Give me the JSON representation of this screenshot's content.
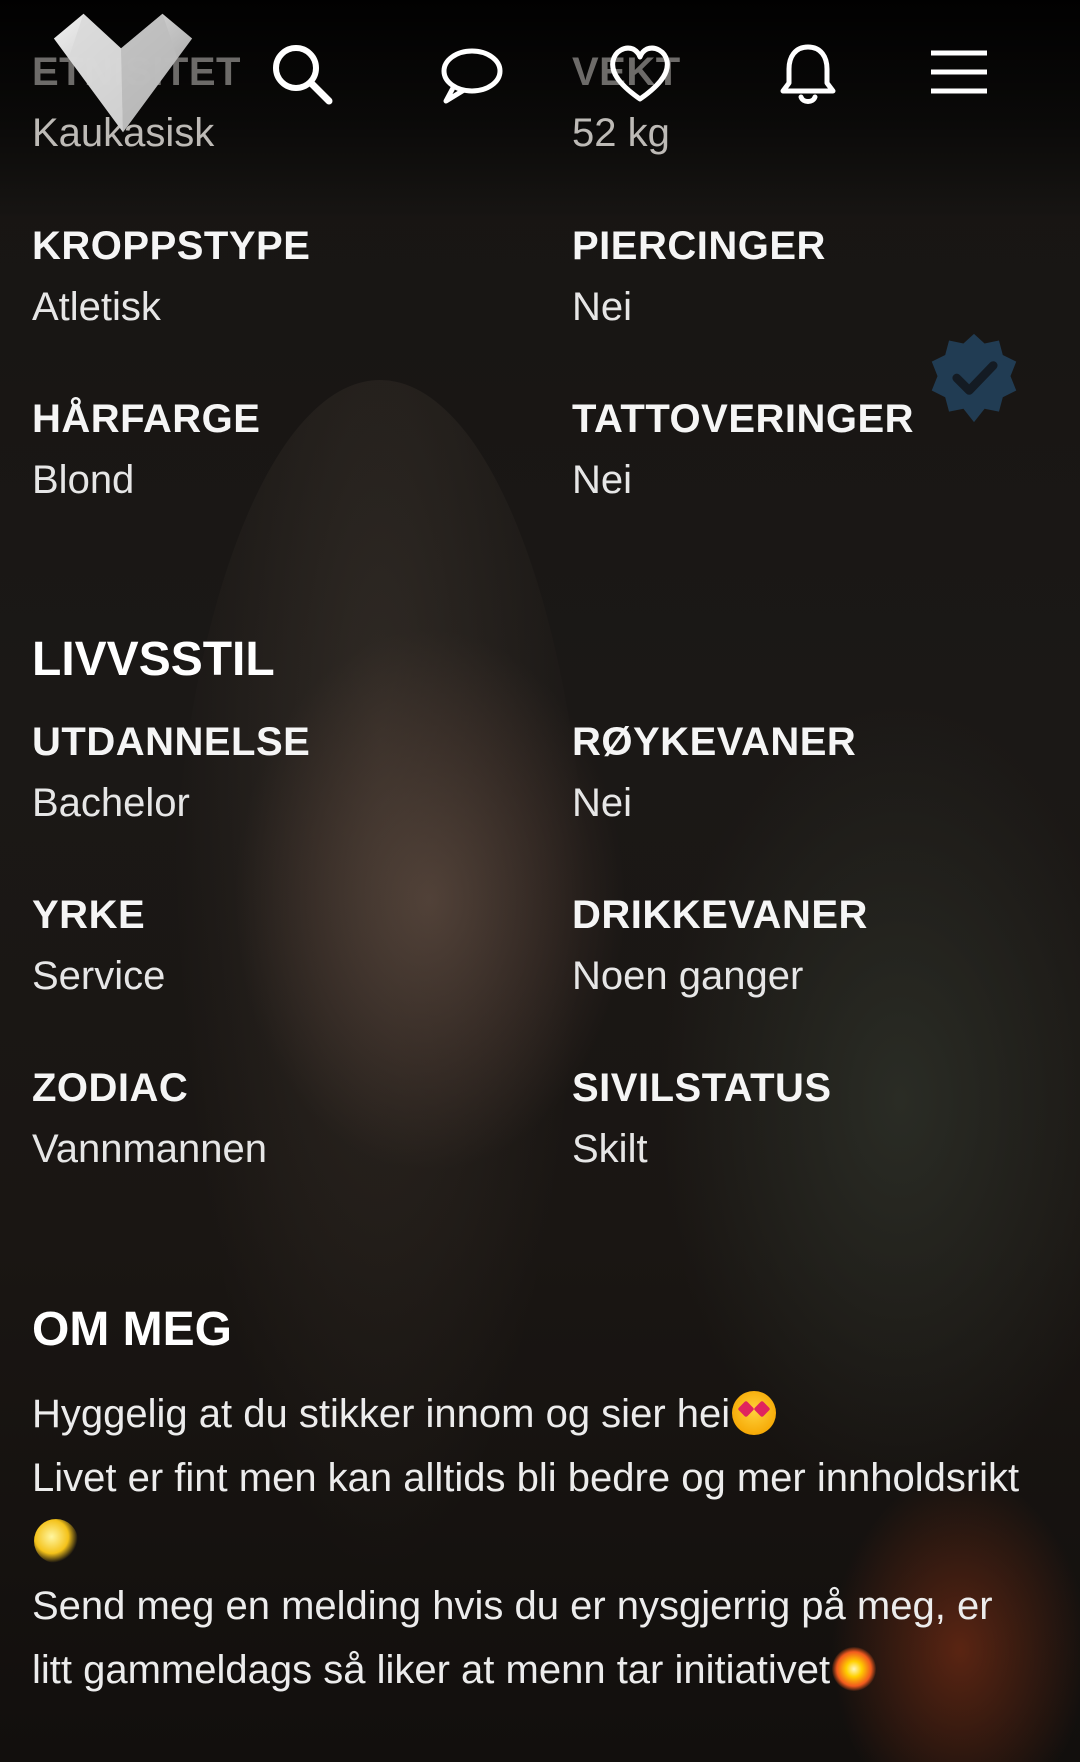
{
  "header": {
    "logo_name": "heart-logo",
    "icons": [
      "search-icon",
      "chat-icon",
      "heart-icon",
      "bell-icon",
      "menu-icon"
    ]
  },
  "partial_row": {
    "left": {
      "label": "ETNISITET",
      "value": "Kaukasisk"
    },
    "right": {
      "label": "VEKT",
      "value": "52 kg"
    }
  },
  "appearance": [
    {
      "left": {
        "label": "KROPPSTYPE",
        "value": "Atletisk"
      },
      "right": {
        "label": "PIERCINGER",
        "value": "Nei"
      }
    },
    {
      "left": {
        "label": "HÅRFARGE",
        "value": "Blond"
      },
      "right": {
        "label": "TATTOVERINGER",
        "value": "Nei"
      }
    }
  ],
  "lifestyle": {
    "title": "LIVVSSTIL",
    "rows": [
      {
        "left": {
          "label": "UTDANNELSE",
          "value": "Bachelor"
        },
        "right": {
          "label": "RØYKEVANER",
          "value": "Nei"
        }
      },
      {
        "left": {
          "label": "YRKE",
          "value": "Service"
        },
        "right": {
          "label": "DRIKKEVANER",
          "value": "Noen ganger"
        }
      },
      {
        "left": {
          "label": "ZODIAC",
          "value": "Vannmannen"
        },
        "right": {
          "label": "SIVILSTATUS",
          "value": "Skilt"
        }
      }
    ]
  },
  "about": {
    "title": "OM MEG",
    "line1": "Hyggelig at du stikker innom og sier hei",
    "line2": "Livet er fint men kan alltids bli bedre og mer innholdsrikt",
    "line3": "Send meg en melding hvis du er nysgjerrig på meg, er litt gammeldags så liker at menn tar initiativet"
  },
  "colors": {
    "verified_badge": "#2c6aa0",
    "text": "#f2f2f2"
  }
}
